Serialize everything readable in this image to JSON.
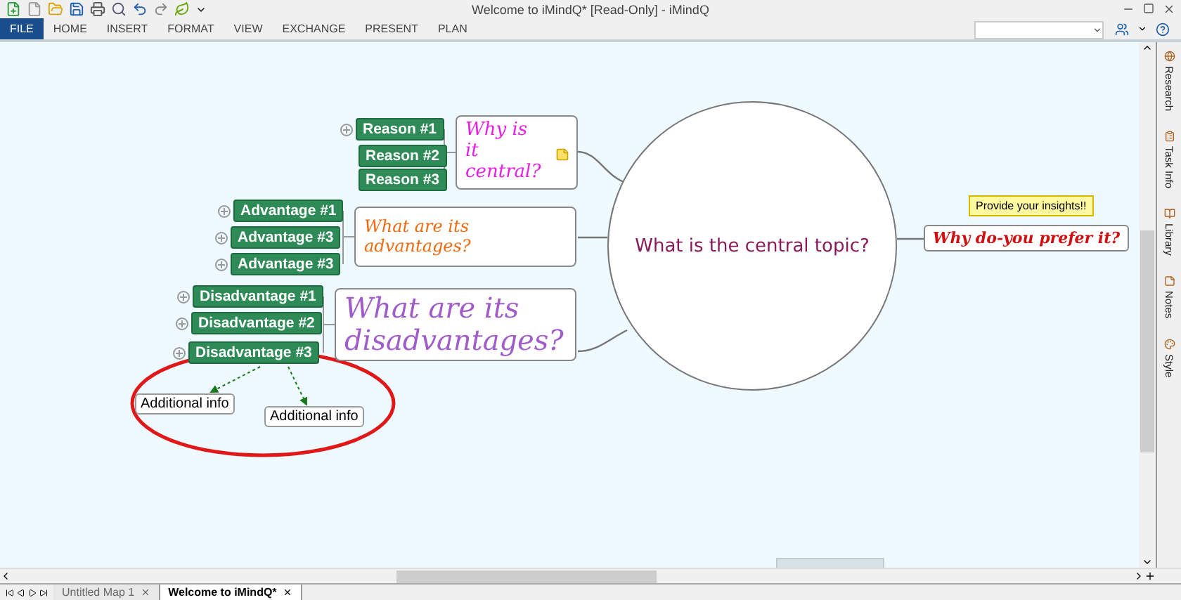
{
  "window": {
    "title": "Welcome to iMindQ* [Read-Only] - iMindQ"
  },
  "ribbon": {
    "tabs": [
      {
        "label": "FILE",
        "selected": true
      },
      {
        "label": "HOME",
        "selected": false
      },
      {
        "label": "INSERT",
        "selected": false
      },
      {
        "label": "FORMAT",
        "selected": false
      },
      {
        "label": "VIEW",
        "selected": false
      },
      {
        "label": "EXCHANGE",
        "selected": false
      },
      {
        "label": "PRESENT",
        "selected": false
      },
      {
        "label": "PLAN",
        "selected": false
      }
    ]
  },
  "map": {
    "central_topic": "What is the central topic?",
    "branches": [
      {
        "label": "Why is it central?",
        "color": "#e81ee8",
        "has_note": true,
        "children": [
          {
            "label": "Reason #1",
            "expandable": true
          },
          {
            "label": "Reason #2",
            "expandable": false
          },
          {
            "label": "Reason #3",
            "expandable": false
          }
        ]
      },
      {
        "label": "What are its advantages?",
        "color": "#f06a10",
        "has_note": false,
        "children": [
          {
            "label": "Advantage #1",
            "expandable": true
          },
          {
            "label": "Advantage #3",
            "expandable": true
          },
          {
            "label": "Advantage #3",
            "expandable": true
          }
        ]
      },
      {
        "label": "What are its disadvantages?",
        "color": "#a05cc8",
        "has_note": false,
        "children": [
          {
            "label": "Disadvantage #1",
            "expandable": true
          },
          {
            "label": "Disadvantage #2",
            "expandable": true
          },
          {
            "label": "Disadvantage #3",
            "expandable": true,
            "details": [
              {
                "label": "Additional info"
              },
              {
                "label": "Additional info"
              }
            ]
          }
        ]
      }
    ],
    "right_topic": {
      "label": "Why do-you prefer it?",
      "callout": "Provide your insights!!"
    }
  },
  "side_panel": {
    "items": [
      {
        "label": "Research"
      },
      {
        "label": "Task Info"
      },
      {
        "label": "Library"
      },
      {
        "label": "Notes"
      },
      {
        "label": "Style"
      }
    ]
  },
  "document_tabs": [
    {
      "label": "Untitled Map 1",
      "selected": false
    },
    {
      "label": "Welcome to iMindQ*",
      "selected": true
    }
  ]
}
